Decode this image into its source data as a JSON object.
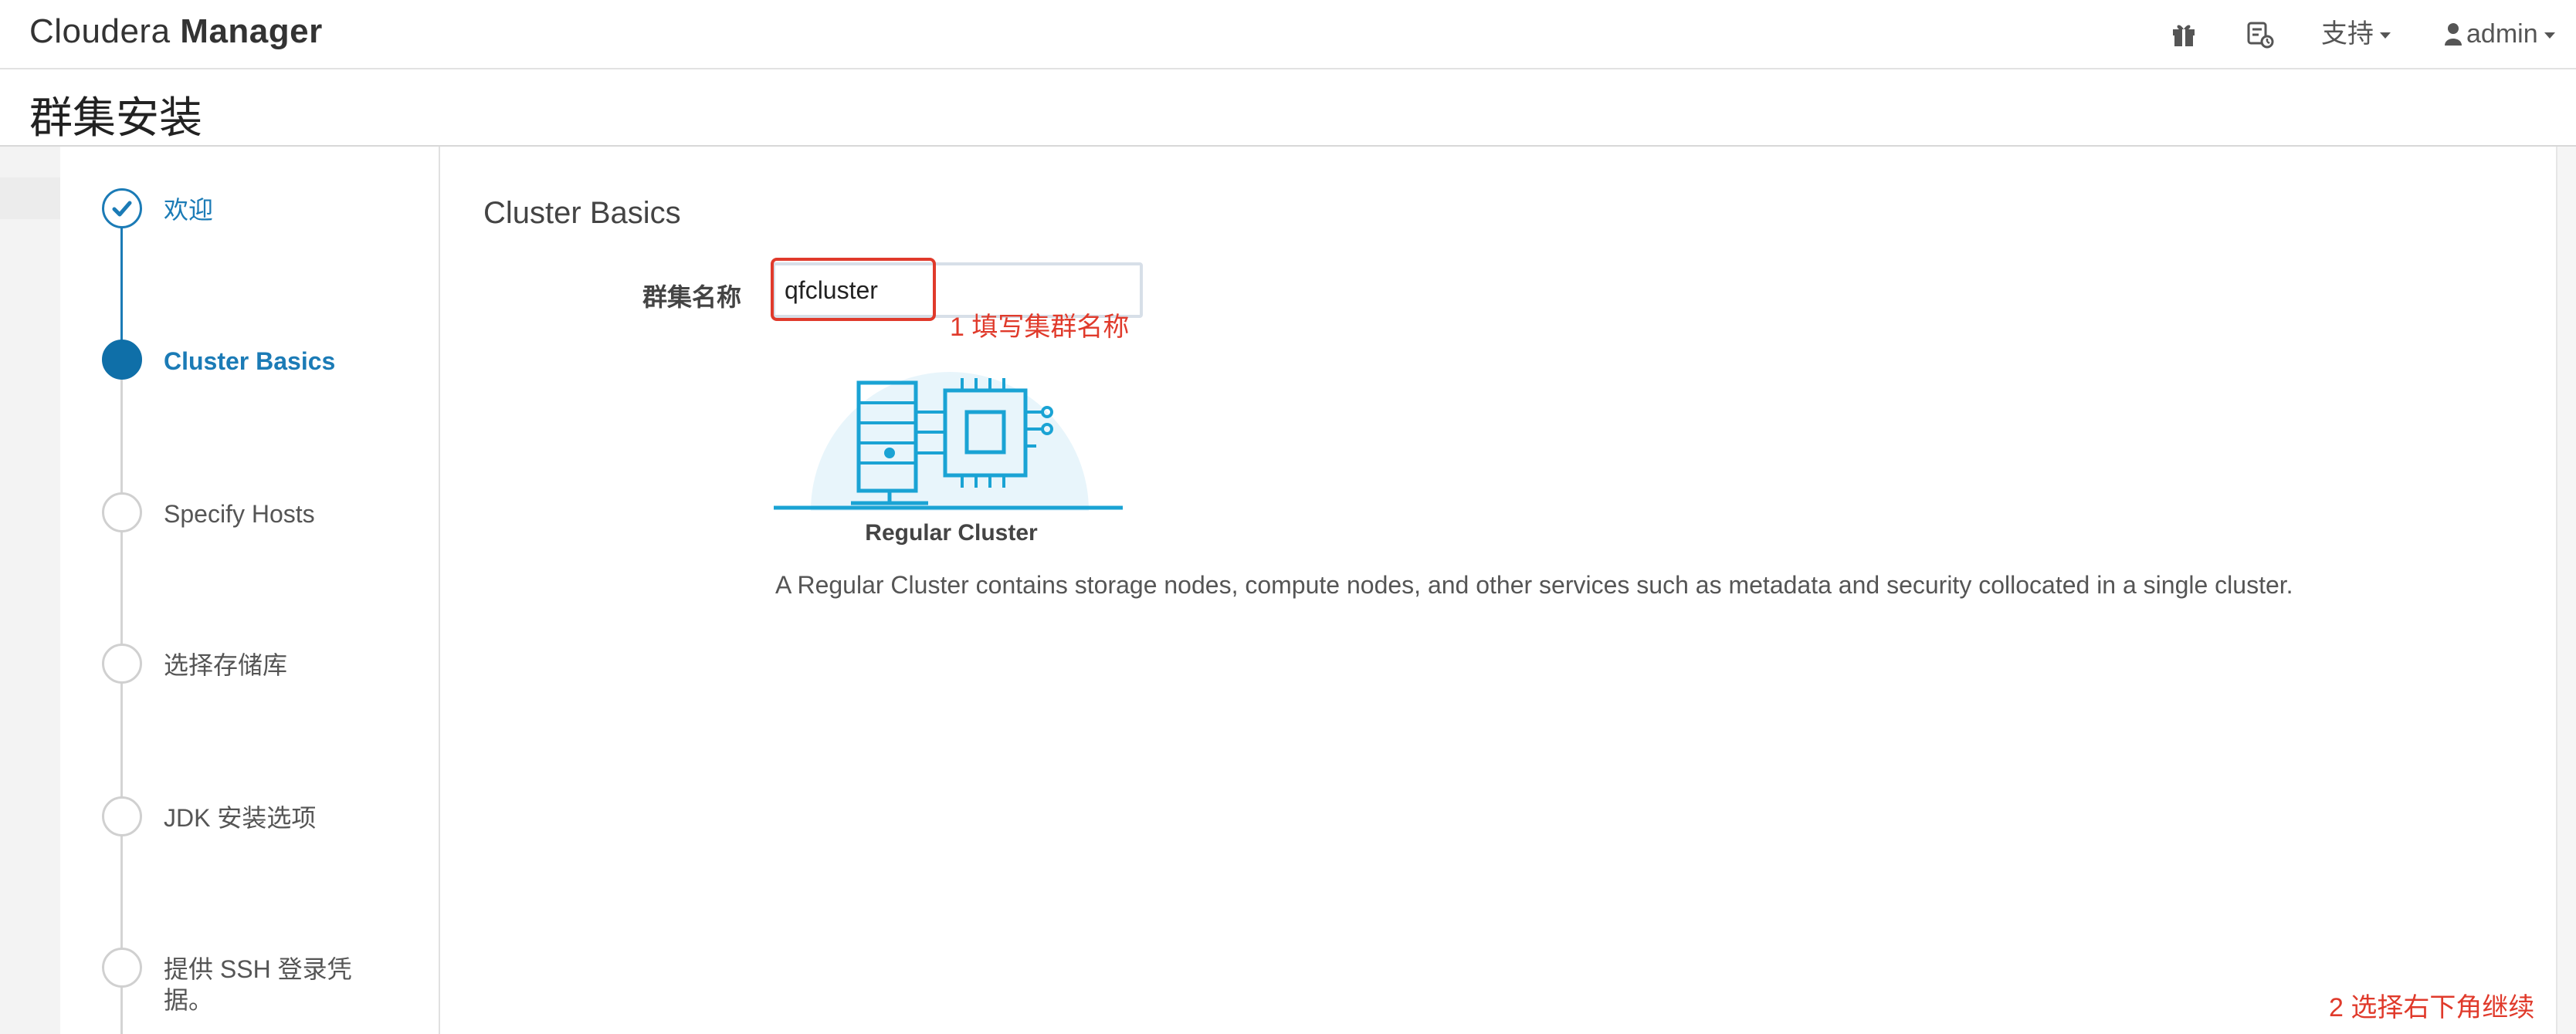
{
  "navbar": {
    "brand_light": "Cloudera",
    "brand_bold": "Manager",
    "support_label": "支持",
    "user_label": "admin"
  },
  "page": {
    "title": "群集安装"
  },
  "wizard": {
    "steps": [
      {
        "label": "欢迎",
        "state": "done"
      },
      {
        "label": "Cluster Basics",
        "state": "active"
      },
      {
        "label": "Specify Hosts",
        "state": "todo"
      },
      {
        "label": "选择存储库",
        "state": "todo"
      },
      {
        "label": "JDK 安装选项",
        "state": "todo"
      },
      {
        "label": "提供 SSH 登录凭据。",
        "state": "todo"
      }
    ]
  },
  "main": {
    "section_title": "Cluster Basics",
    "cluster_name_label": "群集名称",
    "cluster_name_value": "qfcluster",
    "cluster_type_label": "Regular Cluster",
    "cluster_type_description": "A Regular Cluster contains storage nodes, compute nodes, and other services such as metadata and security collocated in a single cluster."
  },
  "annotations": {
    "note1": "1 填写集群名称",
    "note2": "2 选择右下角继续"
  },
  "colors": {
    "accent": "#1b7bb6",
    "active_step": "#0f6fa8",
    "annotation_red": "#e03a2b",
    "illustration": "#1aa3d4"
  },
  "icons": {
    "gift": "gift-icon",
    "parcel": "parcel-icon",
    "user": "user-icon",
    "check": "check-icon"
  }
}
